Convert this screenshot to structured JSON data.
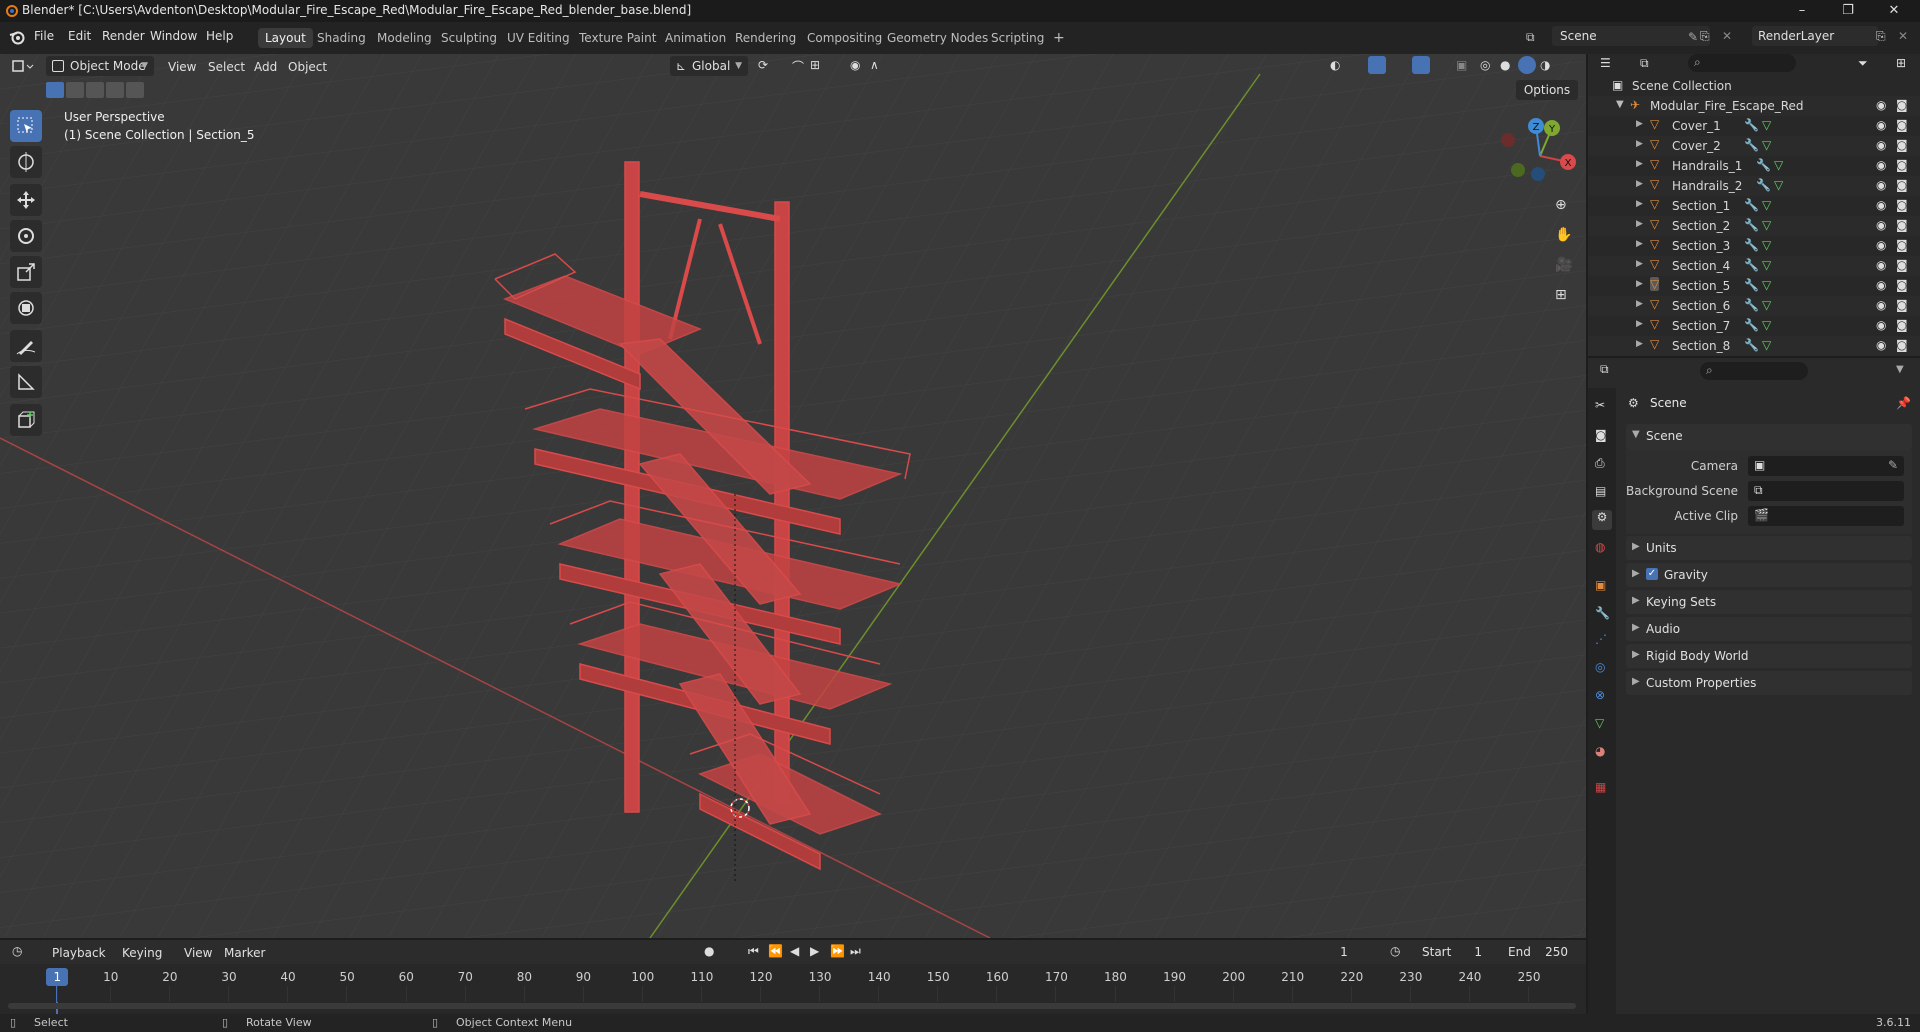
{
  "window": {
    "title": "Blender* [C:\\Users\\Avdenton\\Desktop\\Modular_Fire_Escape_Red\\Modular_Fire_Escape_Red_blender_base.blend]",
    "minimize": "–",
    "maximize": "❐",
    "close": "✕"
  },
  "menu": [
    "File",
    "Edit",
    "Render",
    "Window",
    "Help"
  ],
  "workspaces": [
    "Layout",
    "Shading",
    "Modeling",
    "Sculpting",
    "UV Editing",
    "Texture Paint",
    "Animation",
    "Rendering",
    "Compositing",
    "Geometry Nodes",
    "Scripting",
    "+"
  ],
  "scene_field": "Scene",
  "renderlayer_field": "RenderLayer",
  "viewport": {
    "mode": "Object Mode",
    "menus": [
      "View",
      "Select",
      "Add",
      "Object"
    ],
    "orientation": "Global",
    "options": "Options",
    "info_line1": "User Perspective",
    "info_line2": "(1) Scene Collection | Section_5",
    "gizmo_axes": {
      "x": "X",
      "y": "Y",
      "z": "Z"
    }
  },
  "outliner": {
    "root": "Scene Collection",
    "collection": "Modular_Fire_Escape_Red",
    "items": [
      "Cover_1",
      "Cover_2",
      "Handrails_1",
      "Handrails_2",
      "Section_1",
      "Section_2",
      "Section_3",
      "Section_4",
      "Section_5",
      "Section_6",
      "Section_7",
      "Section_8"
    ]
  },
  "properties": {
    "header": "Scene",
    "panel_scene": "Scene",
    "camera_label": "Camera",
    "bg_scene_label": "Background Scene",
    "active_clip_label": "Active Clip",
    "panels": [
      "Units",
      "Gravity",
      "Keying Sets",
      "Audio",
      "Rigid Body World",
      "Custom Properties"
    ]
  },
  "timeline": {
    "menus": [
      "Playback",
      "Keying",
      "View",
      "Marker"
    ],
    "current_frame": "1",
    "start_label": "Start",
    "start": "1",
    "end_label": "End",
    "end": "250",
    "ruler": [
      "1",
      "10",
      "20",
      "30",
      "40",
      "50",
      "60",
      "70",
      "80",
      "90",
      "100",
      "110",
      "120",
      "130",
      "140",
      "150",
      "160",
      "170",
      "180",
      "190",
      "200",
      "210",
      "220",
      "230",
      "240",
      "250"
    ]
  },
  "status": {
    "select": "Select",
    "rotate": "Rotate View",
    "context": "Object Context Menu",
    "version": "3.6.11"
  },
  "colors": {
    "accent": "#4772b3",
    "model": "#d94a4a",
    "x_axis": "#b34a4a",
    "y_axis": "#7ea832",
    "z_axis": "#3f8bd6"
  }
}
